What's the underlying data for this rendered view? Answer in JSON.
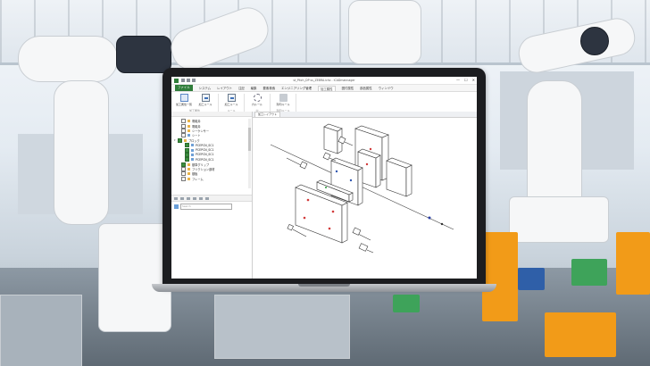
{
  "window": {
    "title": "st_Pitch_DP ss_ZEBRA.ichz - iCADmannager",
    "controls": [
      "—",
      "☐",
      "✕"
    ]
  },
  "ribbon_tabs": [
    "ファイル",
    "システム",
    "レイアウト",
    "注記",
    "編集",
    "要素検索",
    "エンジニアリング管理",
    "加工属性",
    "図付属性",
    "部品属性",
    "ウィンドウ"
  ],
  "active_tab_index": 7,
  "ribbon_groups": [
    {
      "label": "加工属性",
      "buttons": [
        "加工属性一覧",
        "加工ルール"
      ]
    },
    {
      "label": "ルール",
      "buttons": [
        "加工ルール"
      ]
    },
    {
      "label": "穴",
      "buttons": [
        "穴ルール"
      ]
    },
    {
      "label": "刻印ルール",
      "buttons": [
        "刻印ルール"
      ]
    }
  ],
  "tree": {
    "items": [
      {
        "label": "電磁弁",
        "checked": false,
        "indent": 1,
        "icon": "folder"
      },
      {
        "label": "電磁弁",
        "checked": false,
        "indent": 1,
        "icon": "folder"
      },
      {
        "label": "シーケンサー",
        "checked": false,
        "indent": 1,
        "icon": "folder"
      },
      {
        "label": "シート",
        "checked": false,
        "indent": 1,
        "icon": "sheet"
      },
      {
        "label": "ブロック",
        "checked": true,
        "indent": 0,
        "icon": "folder"
      },
      {
        "label": "PCEPCN_SC1",
        "checked": true,
        "indent": 2,
        "icon": "sheet"
      },
      {
        "label": "PCEPCN_SC1",
        "checked": true,
        "indent": 2,
        "icon": "sheet"
      },
      {
        "label": "PCEPCN_SC1",
        "checked": true,
        "indent": 2,
        "icon": "sheet"
      },
      {
        "label": "PCEPCN_SC1",
        "checked": true,
        "indent": 2,
        "icon": "sheet"
      },
      {
        "label": "基準グリップ",
        "checked": true,
        "indent": 1,
        "icon": "folder"
      },
      {
        "label": "フリクション部材",
        "checked": false,
        "indent": 1,
        "icon": "folder"
      },
      {
        "label": "基板",
        "checked": false,
        "indent": 1,
        "icon": "folder"
      },
      {
        "label": "フレーム",
        "checked": false,
        "indent": 1,
        "icon": "folder"
      }
    ]
  },
  "search": {
    "placeholder": "Search"
  },
  "canvas": {
    "tab_label": "加工レイアウト"
  },
  "icons": {
    "app": "icad-app-icon",
    "minimize": "minimize-icon",
    "maximize": "maximize-icon",
    "close": "close-icon"
  },
  "colors": {
    "accent": "#2f7d3a",
    "hole_red": "#d23a3a",
    "hole_blue": "#2f56b0",
    "axis_blue": "#2b3fa6"
  }
}
